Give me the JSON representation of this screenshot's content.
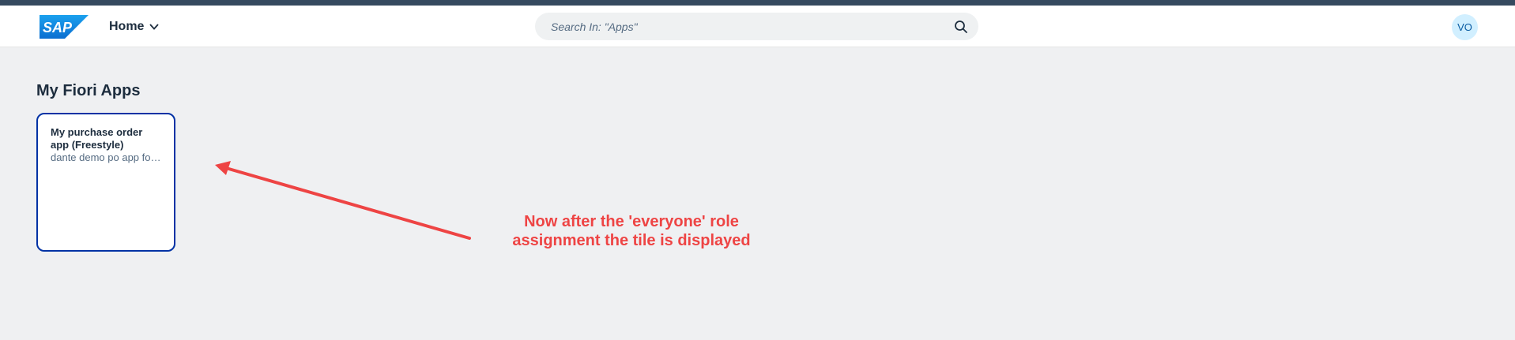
{
  "shell": {
    "logo_text": "SAP",
    "home_label": "Home",
    "search_placeholder": "Search In: \"Apps\"",
    "avatar_initials": "VO"
  },
  "main": {
    "section_title": "My Fiori Apps",
    "tiles": [
      {
        "title": "My purchase order app (Freestyle)",
        "subtitle": "dante demo po app for ..."
      }
    ]
  },
  "annotation": {
    "text": "Now after the 'everyone' role assignment the tile is displayed",
    "color": "#ee4444"
  },
  "colors": {
    "brand_blue": "#0a6ed1",
    "tile_border": "#0032a5",
    "background": "#eff0f2"
  }
}
